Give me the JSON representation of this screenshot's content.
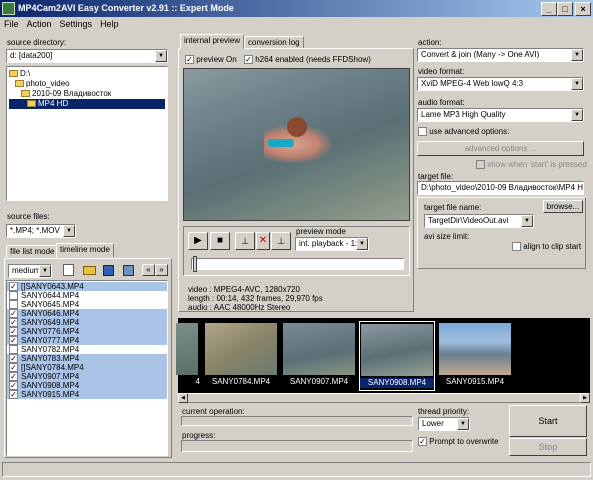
{
  "window": {
    "title": "MP4Cam2AVI Easy Converter v2.91 :: Expert Mode",
    "minimize": "_",
    "maximize": "□",
    "close": "×"
  },
  "menu": [
    "File",
    "Action",
    "Settings",
    "Help"
  ],
  "source": {
    "dir_label": "source directory:",
    "drive": "d: [data200]",
    "tree": [
      "D:\\",
      "photo_video",
      "2010-09 Владивосток",
      "MP4 HD"
    ],
    "files_label": "source files:",
    "mask": "*.MP4; *.MOV"
  },
  "left_tabs": [
    "file list mode",
    "timeline mode"
  ],
  "size_combo": "medium",
  "files": [
    {
      "name": "[]SANY0643.MP4",
      "checked": true
    },
    {
      "name": "SANY0644.MP4",
      "checked": false
    },
    {
      "name": "SANY0645.MP4",
      "checked": false
    },
    {
      "name": "SANY0646.MP4",
      "checked": true
    },
    {
      "name": "SANY0649.MP4",
      "checked": true
    },
    {
      "name": "SANY0776.MP4",
      "checked": true
    },
    {
      "name": "SANY0777.MP4",
      "checked": true
    },
    {
      "name": "SANY0782.MP4",
      "checked": false
    },
    {
      "name": "SANY0783.MP4",
      "checked": true
    },
    {
      "name": "[]SANY0784.MP4",
      "checked": true
    },
    {
      "name": "SANY0907.MP4",
      "checked": true
    },
    {
      "name": "SANY0908.MP4",
      "checked": true
    },
    {
      "name": "SANY0915.MP4",
      "checked": true
    }
  ],
  "center_tabs": [
    "internal preview",
    "conversion log"
  ],
  "preview": {
    "preview_on": "preview On",
    "h264": "h264 enabled (needs FFDShow)",
    "mode_label": "preview mode",
    "mode_value": "int. playback - 1x",
    "info": [
      "video : MPEG4-AVC, 1280x720",
      "length : 00:14, 432 frames, 29,970 fps",
      "audio : AAC 48000Hz Stereo"
    ]
  },
  "right": {
    "action_label": "action:",
    "action": "Convert & join (Many -> One AVI)",
    "vformat_label": "video format:",
    "vformat": "XviD MPEG-4 Web lowQ 4:3",
    "aformat_label": "audio format:",
    "aformat": "Lame MP3 High Quality",
    "adv_check": "use advanced options:",
    "adv_btn": "advanced options ...",
    "show_when": "show when 'start' is pressed",
    "target_label": "target file:",
    "target": "D:\\photo_video\\2010-09 Владивосток\\MP4 H",
    "tname_label": "target file name:",
    "browse": "browse...",
    "tname": "TargetDir\\VideoOut.avi",
    "avi_limit": "avi size limit:",
    "align": "align to clip start"
  },
  "thumbs": [
    {
      "name": "4"
    },
    {
      "name": "SANY0784.MP4"
    },
    {
      "name": "SANY0907.MP4"
    },
    {
      "name": "SANY0908.MP4"
    },
    {
      "name": "SANY0915.MP4"
    },
    {
      "name": ""
    }
  ],
  "bottom": {
    "current_op": "current operation:",
    "progress": "progress:",
    "thread_label": "thread priority:",
    "thread": "Lower",
    "prompt": "Prompt to overwrite",
    "start": "Start",
    "stop": "Stop"
  }
}
